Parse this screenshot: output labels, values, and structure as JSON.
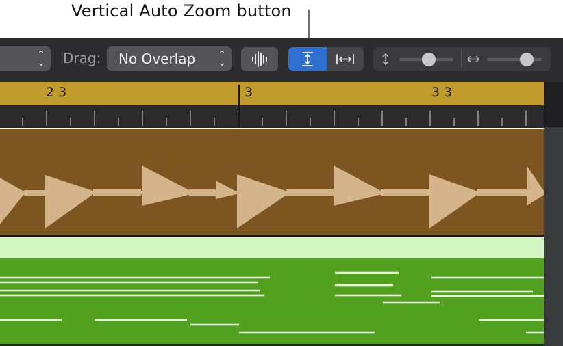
{
  "callout": {
    "text": "Vertical Auto Zoom button"
  },
  "toolbar": {
    "drag_label": "Drag:",
    "drag_value": "No Overlap",
    "vertical_auto_zoom_active": true
  },
  "ruler": {
    "markers": [
      {
        "label": "2 3"
      },
      {
        "label": "3"
      },
      {
        "label": "3 3"
      }
    ]
  },
  "colors": {
    "accent_blue": "#2f6fd0",
    "ruler_gold": "#c19b2c",
    "audio_region": "#7d5520",
    "waveform": "#d4b48b",
    "midi_region": "#52a11f",
    "midi_header": "#d3f7c0",
    "midi_notes": "#e9f7e1"
  },
  "icons": {
    "popup_chevron": "chevron-up-down-icon",
    "waveform_zoom": "waveform-zoom-icon",
    "vertical_auto_zoom": "vertical-auto-zoom-icon",
    "horizontal_auto_zoom": "horizontal-auto-zoom-icon",
    "vertical_zoom": "vertical-arrows-icon",
    "horizontal_zoom": "horizontal-arrows-icon"
  },
  "sliders": {
    "vertical_zoom_level": 0.55,
    "horizontal_zoom_level": 0.72
  }
}
